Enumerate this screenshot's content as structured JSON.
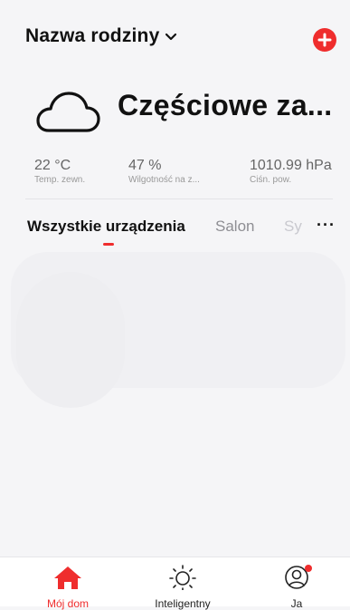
{
  "header": {
    "family_name": "Nazwa rodziny"
  },
  "weather": {
    "condition": "Częściowe za...",
    "stats": [
      {
        "value": "22 °C",
        "label": "Temp. zewn."
      },
      {
        "value": "47 %",
        "label": "Wilgotność na z..."
      },
      {
        "value": "1010.99 hPa",
        "label": "Ciśn. pow."
      }
    ]
  },
  "tabs": [
    {
      "label": "Wszystkie urządzenia",
      "state": "active"
    },
    {
      "label": "Salon",
      "state": "inactive"
    },
    {
      "label": "Sy",
      "state": "faded"
    }
  ],
  "more_label": "···",
  "bottom_nav": [
    {
      "label": "Mój dom",
      "icon": "home-icon",
      "active": true
    },
    {
      "label": "Inteligentny",
      "icon": "sun-icon",
      "active": false
    },
    {
      "label": "Ja",
      "icon": "profile-icon",
      "active": false
    }
  ],
  "colors": {
    "accent": "#ef2d2d",
    "background": "#f5f5f7",
    "text": "#111111",
    "muted": "#8e8e93"
  }
}
